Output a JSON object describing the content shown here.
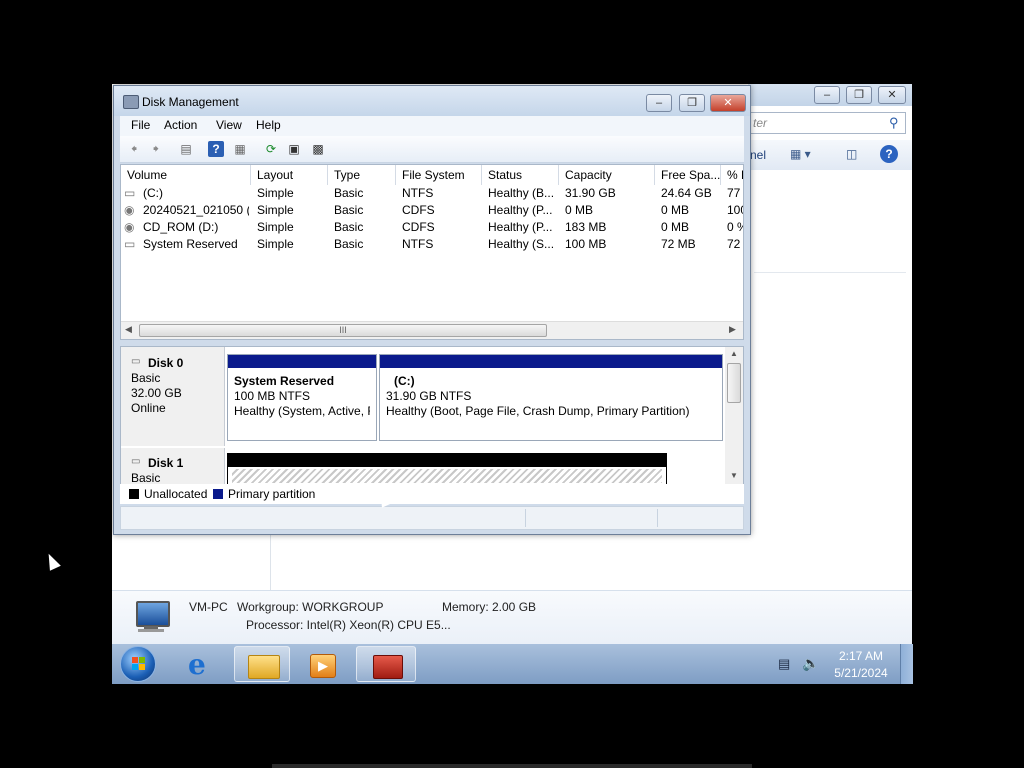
{
  "dialog": {
    "title": "Disk Management",
    "menus": [
      "File",
      "Action",
      "View",
      "Help"
    ]
  },
  "background_window": {
    "search_placeholder": "ter",
    "toolbar_fragment": "nel"
  },
  "volume_list": {
    "columns": [
      "Volume",
      "Layout",
      "Type",
      "File System",
      "Status",
      "Capacity",
      "Free Spa...",
      "% F"
    ],
    "rows": [
      [
        "(C:)",
        "Simple",
        "Basic",
        "NTFS",
        "Healthy (B...",
        "31.90 GB",
        "24.64 GB",
        "77"
      ],
      [
        "20240521_021050 (...",
        "Simple",
        "Basic",
        "CDFS",
        "Healthy (P...",
        "0 MB",
        "0 MB",
        "100"
      ],
      [
        "CD_ROM (D:)",
        "Simple",
        "Basic",
        "CDFS",
        "Healthy (P...",
        "183 MB",
        "0 MB",
        "0 %"
      ],
      [
        "System Reserved",
        "Simple",
        "Basic",
        "NTFS",
        "Healthy (S...",
        "100 MB",
        "72 MB",
        "72"
      ]
    ],
    "scroll_grip": "III"
  },
  "disks": [
    {
      "name": "Disk 0",
      "type": "Basic",
      "size": "32.00 GB",
      "state": "Online",
      "partitions": [
        {
          "name": "System Reserved",
          "size": "100 MB NTFS",
          "status": "Healthy (System, Active, F"
        },
        {
          "name": "(C:)",
          "size": "31.90 GB NTFS",
          "status": "Healthy (Boot, Page File, Crash Dump, Primary Partition)"
        }
      ]
    },
    {
      "name": "Disk 1",
      "type": "Basic"
    }
  ],
  "legend": [
    {
      "label": "Unallocated",
      "color": "#000000"
    },
    {
      "label": "Primary partition",
      "color": "#0a1a8c"
    }
  ],
  "computer_info": {
    "name": "VM-PC",
    "workgroup": "Workgroup: WORKGROUP",
    "memory": "Memory: 2.00 GB",
    "processor": "Processor: Intel(R) Xeon(R) CPU E5..."
  },
  "taskbar": {
    "time": "2:17 AM",
    "date": "5/21/2024"
  },
  "colors": {
    "primary_partition": "#0a1a8c",
    "unallocated": "#000000",
    "taskbar": "#8ba8cc"
  }
}
